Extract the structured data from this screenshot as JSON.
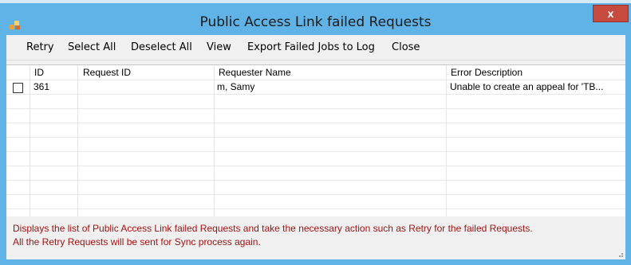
{
  "window": {
    "title": "Public Access Link failed Requests",
    "close_label": "x"
  },
  "menu": {
    "items": [
      "Retry",
      "Select All",
      "Deselect All",
      "View",
      "Export Failed Jobs to Log",
      "Close"
    ]
  },
  "grid": {
    "columns": [
      "ID",
      "Request ID",
      "Requester Name",
      "Error Description"
    ],
    "rows": [
      {
        "checked": false,
        "id": "361",
        "request_id": "",
        "requester_name": "m, Samy",
        "error": "Unable to create an appeal for 'TB..."
      }
    ]
  },
  "help": {
    "line1": "Displays the list of Public Access Link failed Requests and take the necessary action such as Retry for the failed Requests.",
    "line2": "All the Retry Requests will be sent for Sync process again."
  },
  "colors": {
    "titlebar": "#5fb3e6",
    "close": "#c74a3e",
    "help_text": "#a01515"
  }
}
